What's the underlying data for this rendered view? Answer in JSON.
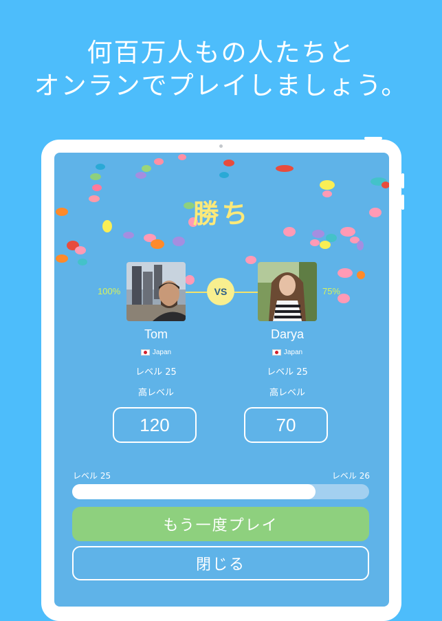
{
  "headline": {
    "line1": "何百万人もの人たちと",
    "line2": "オンランでプレイしましょう。"
  },
  "result": {
    "title": "勝ち",
    "vs_label": "VS"
  },
  "players": [
    {
      "name": "Tom",
      "percent": "100%",
      "country": "Japan",
      "level": "レベル 25",
      "rank": "高レベル",
      "score": "120"
    },
    {
      "name": "Darya",
      "percent": "75%",
      "country": "Japan",
      "level": "レベル 25",
      "rank": "高レベル",
      "score": "70"
    }
  ],
  "progress": {
    "current_level": "レベル 25",
    "next_level": "レベル 26",
    "fraction": 0.82
  },
  "buttons": {
    "play_again": "もう一度プレイ",
    "close": "閉じる"
  },
  "colors": {
    "background": "#4dbdfb",
    "screen": "#5fb3e8",
    "title": "#fbe97a",
    "percent": "#d8f25b",
    "play_again_button": "#8ed07e"
  }
}
